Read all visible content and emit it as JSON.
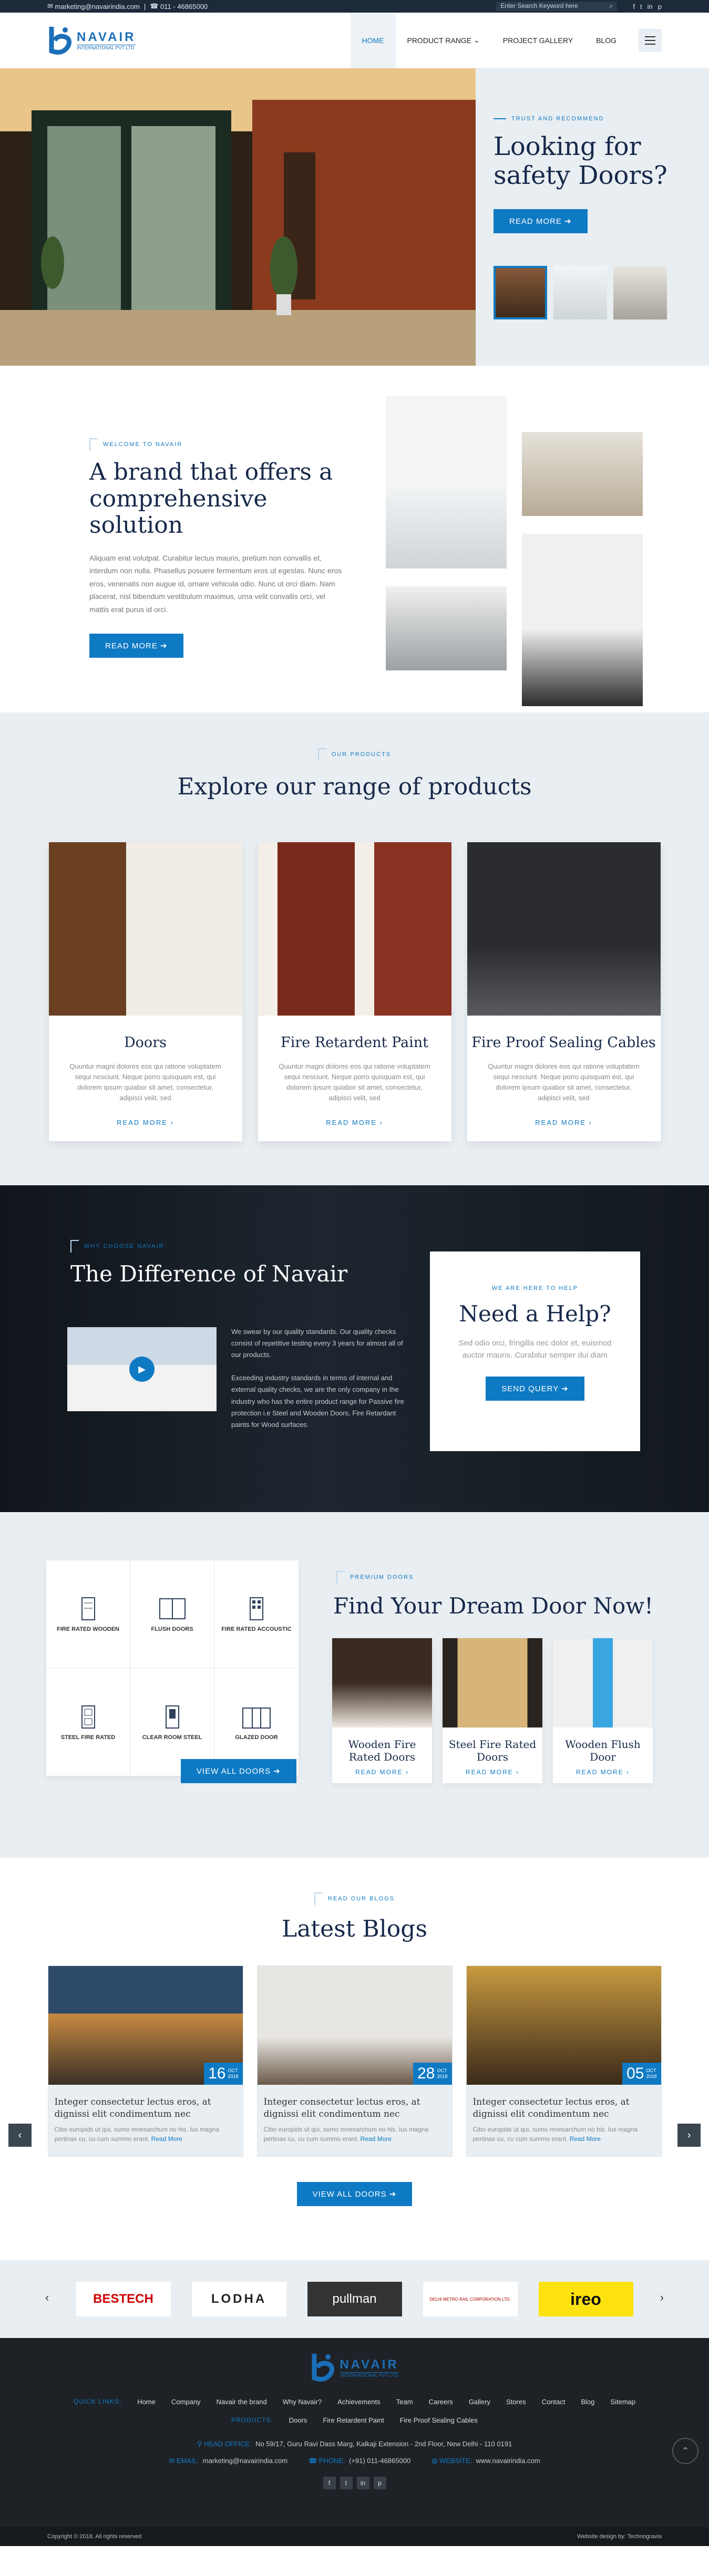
{
  "topbar": {
    "email": "marketing@navairindia.com",
    "phone": "011 - 46865000",
    "search_placeholder": "Enter Search Keyword here",
    "social": [
      "f",
      "t",
      "in",
      "p"
    ]
  },
  "logo": {
    "name": "NAVAIR",
    "sub": "INTERNATIONAL PVT LTD"
  },
  "nav": {
    "items": [
      "HOME",
      "PRODUCT RANGE",
      "PROJECT GALLERY",
      "BLOG"
    ]
  },
  "hero": {
    "tag": "TRUST AND RECOMMEND",
    "title": "Looking for safety Doors?",
    "button": "READ MORE"
  },
  "brand": {
    "tag": "WELCOME TO NAVAIR",
    "title": "A brand that offers a comprehensive solution",
    "text": "Aliquam erat volutpat. Curabitur lectus mauris, pretium non convallis et, interdum non nulla. Phasellus posuere fermentum eros ut egestas. Nunc eros eros, venenatis non augue id, ornare vehicula odio. Nunc ut orci diam. Nam placerat, nisl bibendum vestibulum maximus, urna velit convallis orci, vel mattis erat purus id orci.",
    "button": "READ MORE"
  },
  "products": {
    "tag": "OUR PRODUCTS",
    "title": "Explore our range of products",
    "items": [
      {
        "name": "Doors",
        "text": "Quuntur magni dolores eos qui ratione voluptatem sequi nesciunt. Neque porro quisquam est, qui dolorem ipsum quiabor sit amet, consectetur, adipisci velit, sed",
        "link": "READ MORE"
      },
      {
        "name": "Fire Retardent Paint",
        "text": "Quuntur magni dolores eos qui ratione voluptatem sequi nesciunt. Neque porro quisquam est, qui dolorem ipsum quiabor sit amet, consectetur, adipisci velit, sed",
        "link": "READ MORE"
      },
      {
        "name": "Fire Proof Sealing Cables",
        "text": "Quuntur magni dolores eos qui ratione voluptatem sequi nesciunt. Neque porro quisquam est, qui dolorem ipsum quiabor sit amet, consectetur, adipisci velit, sed",
        "link": "READ MORE"
      }
    ]
  },
  "why": {
    "tag": "WHY CHOOSE NAVAIR",
    "title": "The Difference of Navair",
    "p1": "We swear by our quality standards. Our quality checks consist of repetitive testing every 3 years for almost all of our products.",
    "p2": "Exceeding industry standards in terms of internal and external quality checks, we are the only company in the industry who has the entire product range for Passive fire protection i.e Steel and Wooden Doors, Fire Retardant paints for Wood surfaces."
  },
  "help": {
    "tag": "WE ARE HERE TO HELP",
    "title": "Need a Help?",
    "text": "Sed odio orci, fringilla nec dolor et, euismod auctor mauris. Curabitur semper dui diam",
    "button": "SEND QUERY"
  },
  "find": {
    "tag": "PREMIUM DOORS",
    "title": "Find Your Dream Door Now!",
    "button": "VIEW ALL DOORS",
    "grid": [
      "FIRE RATED WOODEN",
      "FLUSH DOORS",
      "FIRE RATED ACCOUSTIC",
      "STEEL FIRE RATED",
      "CLEAR ROOM STEEL",
      "GLAZED DOOR"
    ],
    "cards": [
      {
        "name": "Wooden Fire Rated Doors",
        "link": "READ MORE"
      },
      {
        "name": "Steel Fire Rated Doors",
        "link": "READ MORE"
      },
      {
        "name": "Wooden Flush Door",
        "link": "READ MORE"
      }
    ]
  },
  "blogs": {
    "tag": "READ OUR BLOGS",
    "title": "Latest Blogs",
    "button": "VIEW ALL DOORS",
    "items": [
      {
        "day": "16",
        "month": "OCT",
        "year": "2018",
        "title": "Integer consectetur lectus eros, at dignissi elit condimentum nec",
        "text": "Cibo europids ut qui, sumo mnesarchum no his. Ius magna pertinax cu, cu cum summo erant.",
        "more": "Read More"
      },
      {
        "day": "28",
        "month": "OCT",
        "year": "2018",
        "title": "Integer consectetur lectus eros, at dignissi elit condimentum nec",
        "text": "Cibo europids ut qui, sumo mnesarchum no his. Ius magna pertinax cu, cu cum summo erant.",
        "more": "Read More"
      },
      {
        "day": "05",
        "month": "OCT",
        "year": "2018",
        "title": "Integer consectetur lectus eros, at dignissi elit condimentum nec",
        "text": "Cibo europids ut qui, sumo mnesarchum no his. Ius magna pertinax cu, cu cum summo erant.",
        "more": "Read More"
      }
    ]
  },
  "clients": [
    "BESTECH",
    "LODHA",
    "pullman",
    "DELHI METRO RAIL CORPORATION LTD.",
    "ireo"
  ],
  "footer": {
    "quick_label": "QUICK LINKS:",
    "quick": [
      "Home",
      "Company",
      "Navair the brand",
      "Why Navair?",
      "Achievements",
      "Team",
      "Careers",
      "Gallery",
      "Stores",
      "Contact",
      "Blog",
      "Sitemap"
    ],
    "products_label": "PRODUCTS:",
    "products": [
      "Doors",
      "Fire Retardent Paint",
      "Fire Proof Sealing Cables"
    ],
    "addr_label": "HEAD OFFICE:",
    "address": "No 59/17, Guru Ravi Dass Marg, Kalkaji Extension - 2nd Floor, New Delhi - 110 0191",
    "email_label": "EMAIL:",
    "email": "marketing@navairindia.com",
    "phone_label": "PHONE:",
    "phone": "(+91) 011-46865000",
    "web_label": "WEBSITE:",
    "web": "www.navairindia.com",
    "copyright": "Copyright © 2018. All rights reserved",
    "design": "Website design by: Technogravia"
  }
}
